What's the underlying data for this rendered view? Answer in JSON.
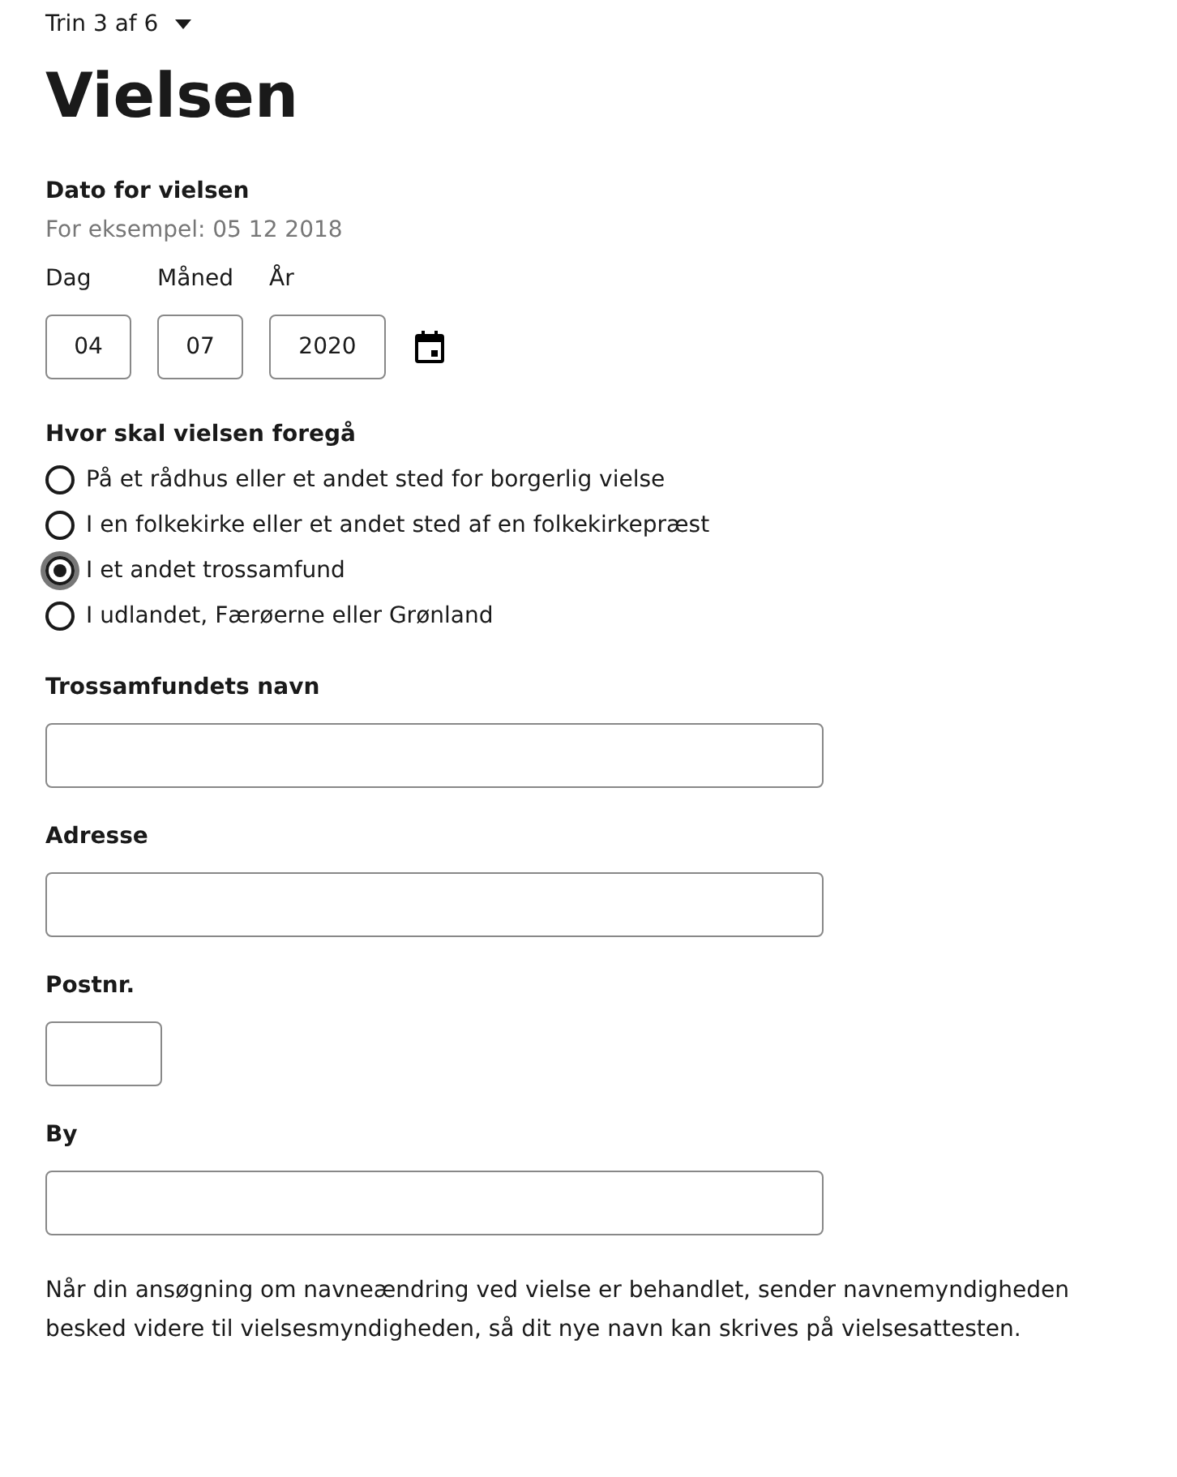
{
  "step": {
    "label": "Trin 3 af 6"
  },
  "title": "Vielsen",
  "date": {
    "label": "Dato for vielsen",
    "hint": "For eksempel: 05 12 2018",
    "parts": [
      {
        "label": "Dag",
        "value": "04",
        "kind": "short"
      },
      {
        "label": "Måned",
        "value": "07",
        "kind": "short"
      },
      {
        "label": "År",
        "value": "2020",
        "kind": "long"
      }
    ]
  },
  "place": {
    "label": "Hvor skal vielsen foregå",
    "options": [
      {
        "label": "På et rådhus eller et andet sted for borgerlig vielse",
        "selected": false
      },
      {
        "label": "I en folkekirke eller et andet sted af en folkekirkepræst",
        "selected": false
      },
      {
        "label": "I et andet trossamfund",
        "selected": true
      },
      {
        "label": "I udlandet, Færøerne eller Grønland",
        "selected": false
      }
    ]
  },
  "fields": [
    {
      "label": "Trossamfundets navn",
      "kind": "wide"
    },
    {
      "label": "Adresse",
      "kind": "wide"
    },
    {
      "label": "Postnr.",
      "kind": "short"
    },
    {
      "label": "By",
      "kind": "wide"
    }
  ],
  "note": "Når din ansøgning om navneændring ved vielse er behandlet, sender navnemyndigheden besked videre til vielsesmyndigheden, så dit nye navn kan skrives på vielsesattesten."
}
